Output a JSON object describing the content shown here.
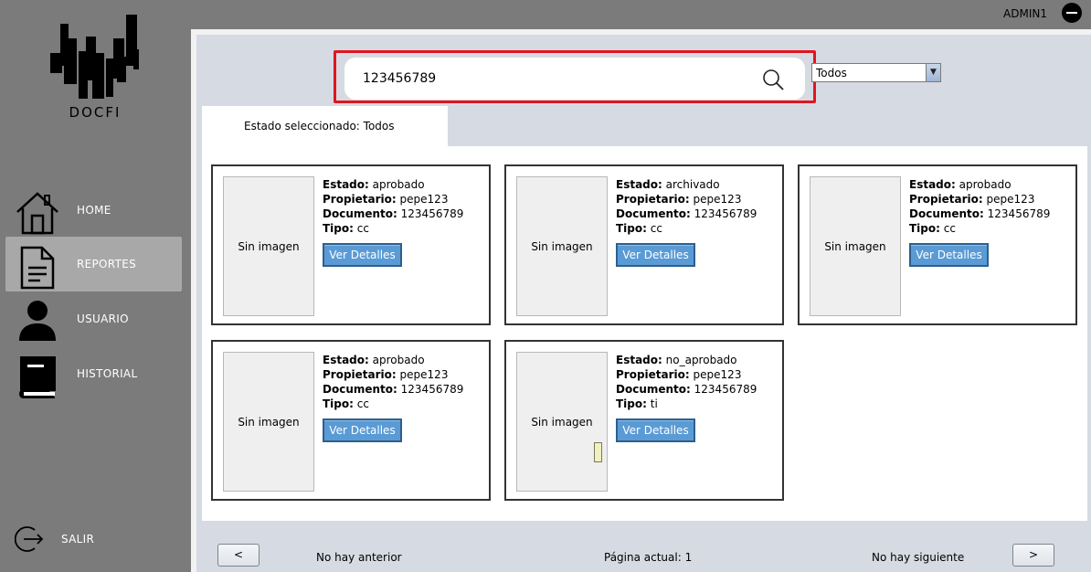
{
  "header": {
    "user": "ADMIN1",
    "logout_icon": "minus-circle-icon"
  },
  "logo": {
    "text": "DOCFI"
  },
  "sidebar": {
    "items": [
      {
        "label": "HOME",
        "icon": "home-icon"
      },
      {
        "label": "REPORTES",
        "icon": "document-icon"
      },
      {
        "label": "USUARIO",
        "icon": "user-icon"
      },
      {
        "label": "HISTORIAL",
        "icon": "book-icon"
      }
    ],
    "logout": {
      "label": "SALIR",
      "icon": "logout-icon"
    }
  },
  "search": {
    "value": "123456789",
    "placeholder": ""
  },
  "filter": {
    "selected": "Todos"
  },
  "tab": {
    "label": "Estado seleccionado: Todos"
  },
  "card_labels": {
    "no_image": "Sin imagen",
    "estado": "Estado:",
    "propietario": "Propietario:",
    "documento": "Documento:",
    "tipo": "Tipo:",
    "details_button": "Ver Detalles"
  },
  "cards": [
    {
      "estado": "aprobado",
      "propietario": "pepe123",
      "documento": "123456789",
      "tipo": "cc"
    },
    {
      "estado": "archivado",
      "propietario": "pepe123",
      "documento": "123456789",
      "tipo": "cc"
    },
    {
      "estado": "aprobado",
      "propietario": "pepe123",
      "documento": "123456789",
      "tipo": "cc"
    },
    {
      "estado": "aprobado",
      "propietario": "pepe123",
      "documento": "123456789",
      "tipo": "cc"
    },
    {
      "estado": "no_aprobado",
      "propietario": "pepe123",
      "documento": "123456789",
      "tipo": "ti"
    }
  ],
  "pagination": {
    "prev": "<",
    "next": ">",
    "prev_text": "No hay anterior",
    "current_text": "Página actual: 1",
    "next_text": "No hay siguiente"
  },
  "colors": {
    "highlight": "#e0161e",
    "button": "#5a9bd5",
    "sidebar": "#7b7b7b"
  }
}
